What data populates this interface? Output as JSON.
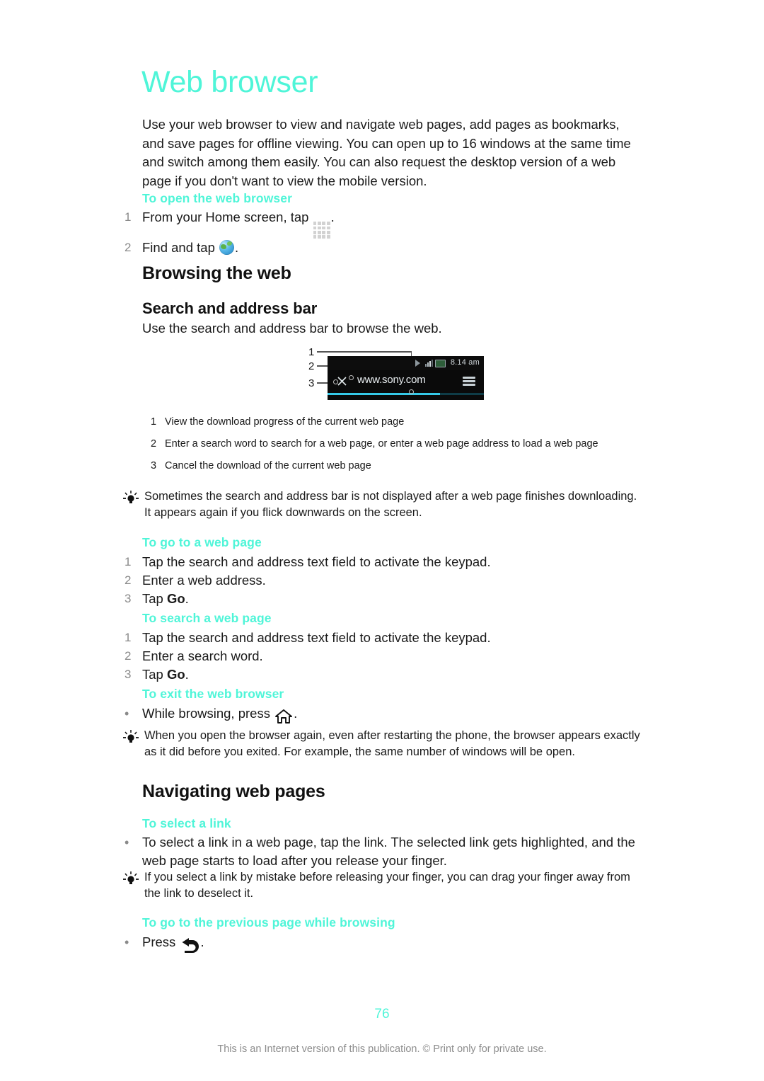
{
  "document": {
    "title": "Web browser",
    "intro": "Use your web browser to view and navigate web pages, add pages as bookmarks, and save pages for offline viewing. You can open up to 16 windows at the same time and switch among them easily. You can also request the desktop version of a web page if you don't want to view the mobile version.",
    "accent_color": "#4FF5D8"
  },
  "sections": {
    "open_browser": {
      "heading": "To open the web browser",
      "steps": [
        {
          "num": "1",
          "text_before": "From your Home screen, tap ",
          "icon": "app-drawer-icon",
          "text_after": "."
        },
        {
          "num": "2",
          "text_before": "Find and tap ",
          "icon": "globe-icon",
          "text_after": "."
        }
      ]
    },
    "browsing_the_web": {
      "heading": "Browsing the web",
      "subheading": "Search and address bar",
      "subtext": "Use the search and address bar to browse the web."
    },
    "illustration": {
      "callout_numbers": [
        "1",
        "2",
        "3"
      ],
      "url_text": "www.sony.com",
      "status_time": "8.14 am",
      "icons": [
        "play-icon",
        "signal-icon",
        "battery-icon",
        "menu-icon",
        "close-x-icon"
      ],
      "captions": [
        {
          "num": "1",
          "text": "View the download progress of the current web page"
        },
        {
          "num": "2",
          "text": "Enter a search word to search for a web page, or enter a web page address to load a web page"
        },
        {
          "num": "3",
          "text": "Cancel the download of the current web page"
        }
      ]
    },
    "tip_1": "Sometimes the search and address bar is not displayed after a web page finishes downloading. It appears again if you flick downwards on the screen.",
    "go_to_web_page": {
      "heading": "To go to a web page",
      "steps": [
        {
          "num": "1",
          "text": "Tap the search and address text field to activate the keypad."
        },
        {
          "num": "2",
          "text": "Enter a web address."
        },
        {
          "num": "3",
          "text_before": "Tap ",
          "bold": "Go",
          "text_after": "."
        }
      ]
    },
    "search_web_page": {
      "heading": "To search a web page",
      "steps": [
        {
          "num": "1",
          "text": "Tap the search and address text field to activate the keypad."
        },
        {
          "num": "2",
          "text": "Enter a search word."
        },
        {
          "num": "3",
          "text_before": "Tap ",
          "bold": "Go",
          "text_after": "."
        }
      ]
    },
    "exit_browser": {
      "heading": "To exit the web browser",
      "bullet_before": "While browsing, press ",
      "bullet_icon": "home-icon",
      "bullet_after": "."
    },
    "tip_2": "When you open the browser again, even after restarting the phone, the browser appears exactly as it did before you exited. For example, the same number of windows will be open.",
    "navigating_web_pages": {
      "heading": "Navigating web pages",
      "select_link": {
        "heading": "To select a link",
        "bullet": "To select a link in a web page, tap the link. The selected link gets highlighted, and the web page starts to load after you release your finger."
      },
      "tip_3": "If you select a link by mistake before releasing your finger, you can drag your finger away from the link to deselect it.",
      "previous_page": {
        "heading": "To go to the previous page while browsing",
        "bullet_before": "Press ",
        "bullet_icon": "back-arrow-icon",
        "bullet_after": "."
      }
    }
  },
  "footer": {
    "page_number": "76",
    "note": "This is an Internet version of this publication. © Print only for private use."
  }
}
